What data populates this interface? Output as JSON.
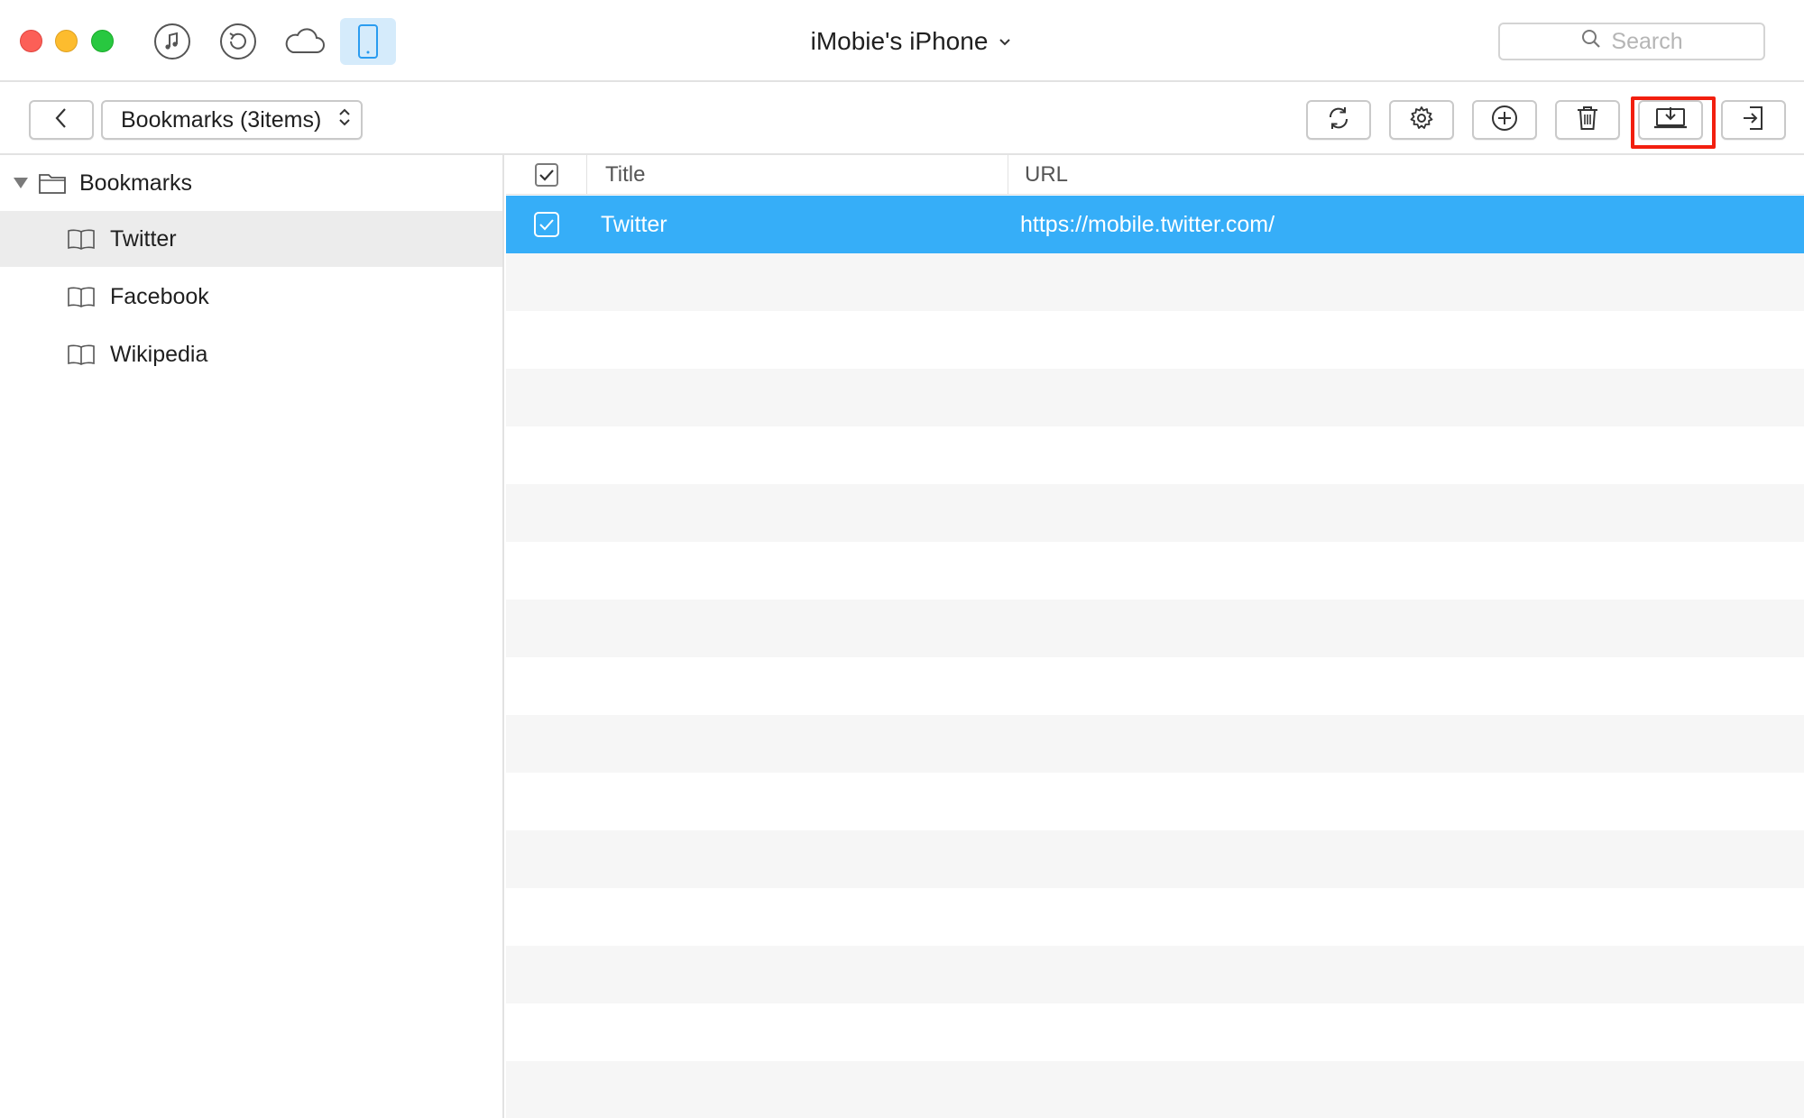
{
  "window": {
    "device_title": "iMobie's iPhone",
    "nav_icons": [
      "music-note-icon",
      "restore-icon",
      "cloud-icon",
      "phone-icon"
    ],
    "active_nav": "phone-icon"
  },
  "search": {
    "placeholder": "Search"
  },
  "toolbar": {
    "dropdown_label": "Bookmarks (3items)",
    "buttons": [
      "refresh-icon",
      "gear-icon",
      "add-icon",
      "trash-icon",
      "export-to-computer-icon",
      "import-icon"
    ],
    "highlighted_button": "export-to-computer-icon"
  },
  "sidebar": {
    "folder": {
      "label": "Bookmarks"
    },
    "items": [
      {
        "label": "Twitter",
        "selected": true
      },
      {
        "label": "Facebook",
        "selected": false
      },
      {
        "label": "Wikipedia",
        "selected": false
      }
    ]
  },
  "table": {
    "columns": {
      "title": "Title",
      "url": "URL"
    },
    "rows": [
      {
        "title": "Twitter",
        "url": "https://mobile.twitter.com/",
        "checked": true,
        "selected": true
      }
    ]
  },
  "colors": {
    "selection": "#36aef8",
    "highlight": "#f21f0f",
    "active_nav_bg": "#d5ebfb",
    "accent_icon": "#2a9cf0"
  }
}
